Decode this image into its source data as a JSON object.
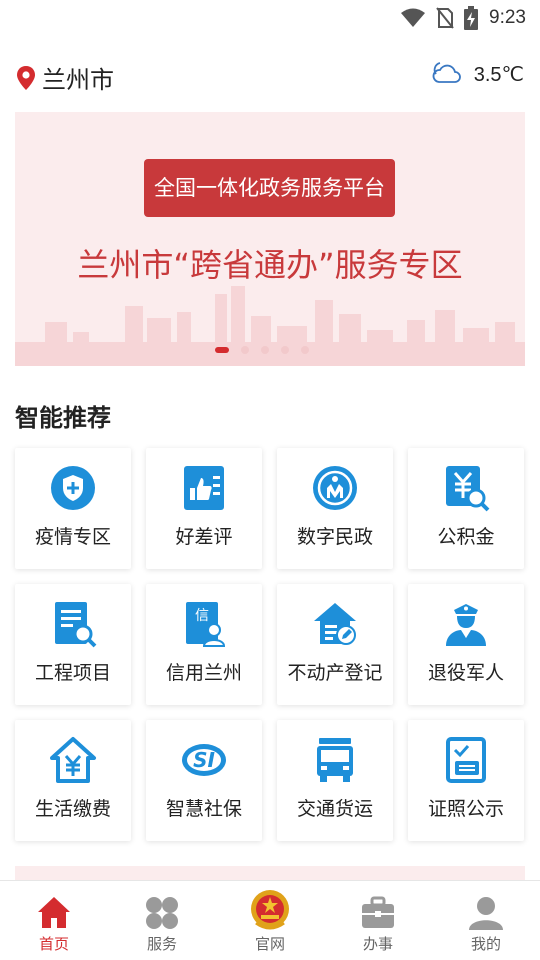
{
  "status_bar": {
    "time": "9:23",
    "icons": [
      "wifi-icon",
      "no-sim-icon",
      "battery-charging-icon"
    ]
  },
  "header": {
    "location": "兰州市",
    "location_icon": "map-pin-icon",
    "weather_icon": "cloudy-icon",
    "temperature": "3.5℃"
  },
  "banner": {
    "badge": "全国一体化政务服务平台",
    "title": "兰州市“跨省通办”服务专区",
    "slides_total": 5,
    "active_slide": 1
  },
  "recommend": {
    "title": "智能推荐",
    "items": [
      {
        "label": "疫情专区",
        "icon": "shield-plus-icon"
      },
      {
        "label": "好差评",
        "icon": "thumbs-up-doc-icon"
      },
      {
        "label": "数字民政",
        "icon": "civil-affairs-icon"
      },
      {
        "label": "公积金",
        "icon": "yuan-search-icon"
      },
      {
        "label": "工程项目",
        "icon": "doc-search-icon"
      },
      {
        "label": "信用兰州",
        "icon": "credit-person-icon"
      },
      {
        "label": "不动产登记",
        "icon": "house-edit-icon"
      },
      {
        "label": "退役军人",
        "icon": "soldier-icon"
      },
      {
        "label": "生活缴费",
        "icon": "house-yuan-icon"
      },
      {
        "label": "智慧社保",
        "icon": "social-security-icon"
      },
      {
        "label": "交通货运",
        "icon": "truck-icon"
      },
      {
        "label": "证照公示",
        "icon": "certificate-icon"
      }
    ]
  },
  "tabbar": {
    "items": [
      {
        "label": "首页",
        "icon": "home-icon",
        "active": true
      },
      {
        "label": "服务",
        "icon": "grid-icon",
        "active": false
      },
      {
        "label": "官网",
        "icon": "emblem-icon",
        "active": false
      },
      {
        "label": "办事",
        "icon": "briefcase-icon",
        "active": false
      },
      {
        "label": "我的",
        "icon": "user-icon",
        "active": false
      }
    ]
  },
  "colors": {
    "accent": "#d42c2f",
    "icon_blue": "#1e8fd9",
    "banner_bg": "#fbeced"
  }
}
